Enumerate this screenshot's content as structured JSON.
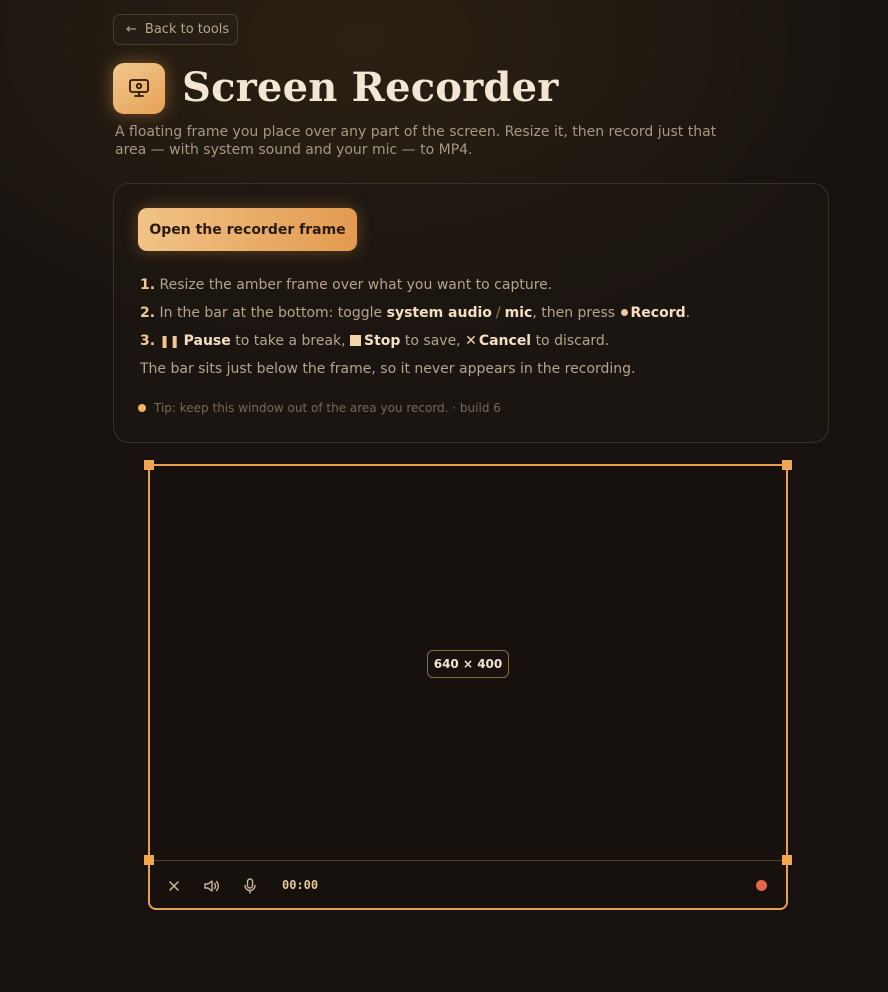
{
  "nav": {
    "back_label": "Back to tools"
  },
  "header": {
    "title": "Screen Recorder",
    "subtitle": "A floating frame you place over any part of the screen. Resize it, then record just that area — with system sound and your mic — to MP4.",
    "icon": "monitor-icon"
  },
  "card": {
    "open_button": "Open the recorder frame",
    "steps": {
      "s1_num": "1.",
      "s1_text": "Resize the amber frame over what you want to capture.",
      "s2_num": "2.",
      "s2_pre": "In the bar at the bottom: toggle",
      "s2_audio": "system audio",
      "s2_slash": "/",
      "s2_mic": "mic",
      "s2_mid": ", then press",
      "s2_record": "Record",
      "s2_end": ".",
      "s3_num": "3.",
      "s3_pause": "Pause",
      "s3_t1": "to take a break,",
      "s3_stop": "Stop",
      "s3_t2": "to save,",
      "s3_cancel": "Cancel",
      "s3_t3": "to discard.",
      "note": "The bar sits just below the frame, so it never appears in the recording."
    },
    "tip": "Tip: keep this window out of the area you record. · build 6"
  },
  "frame": {
    "size_label": "640 × 400",
    "timer": "00:00",
    "accent": "#e79f52",
    "record_color": "#e2664a"
  }
}
